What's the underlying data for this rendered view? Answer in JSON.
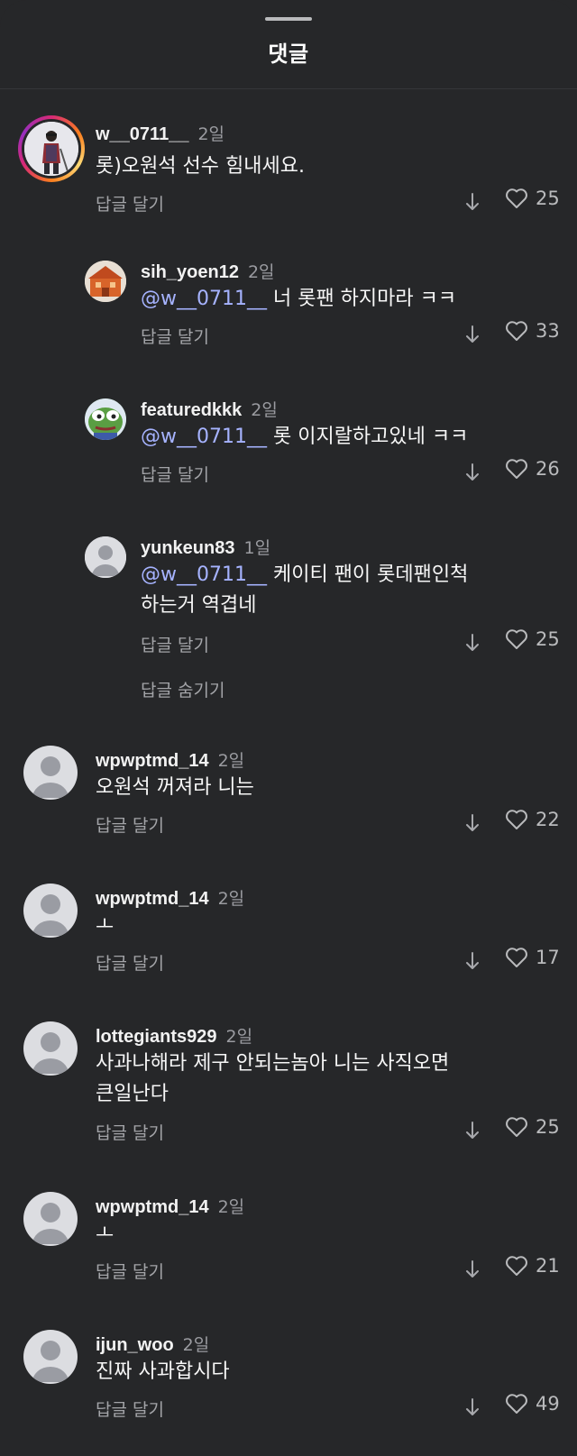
{
  "sheet": {
    "title": "댓글"
  },
  "labels": {
    "reply": "답글 달기",
    "hide_replies": "답글 숨기기"
  },
  "comments": [
    {
      "username": "w__0711__",
      "time": "2일",
      "text": "롯)오원석 선수 힘내세요.",
      "likes": "25"
    },
    {
      "username": "sih_yoen12",
      "time": "2일",
      "mention": "@w__0711__",
      "text": " 너 롯팬 하지마라 ㅋㅋ",
      "likes": "33"
    },
    {
      "username": "featuredkkk",
      "time": "2일",
      "mention": "@w__0711__",
      "text": " 롯 이지랄하고있네 ㅋㅋ",
      "likes": "26"
    },
    {
      "username": "yunkeun83",
      "time": "1일",
      "mention": "@w__0711__",
      "text": " 케이티 팬이 롯데팬인척\n하는거 역겹네",
      "likes": "25"
    },
    {
      "username": "wpwptmd_14",
      "time": "2일",
      "text": "오원석 꺼져라 니는",
      "likes": "22"
    },
    {
      "username": "wpwptmd_14",
      "time": "2일",
      "text": "ㅗ",
      "likes": "17"
    },
    {
      "username": "lottegiants929",
      "time": "2일",
      "text": "사과나해라 제구 안되는놈아 니는 사직오면\n큰일난다",
      "likes": "25"
    },
    {
      "username": "wpwptmd_14",
      "time": "2일",
      "text": "ㅗ",
      "likes": "21"
    },
    {
      "username": "ijun_woo",
      "time": "2일",
      "text": "진짜 사과합시다",
      "likes": "49"
    }
  ],
  "colors": {
    "background": "#262729",
    "mention": "#a6b3ff",
    "secondary_text": "#a3a4a8"
  },
  "icons": {
    "like": "heart-icon",
    "translate": "arrow-down-icon"
  }
}
